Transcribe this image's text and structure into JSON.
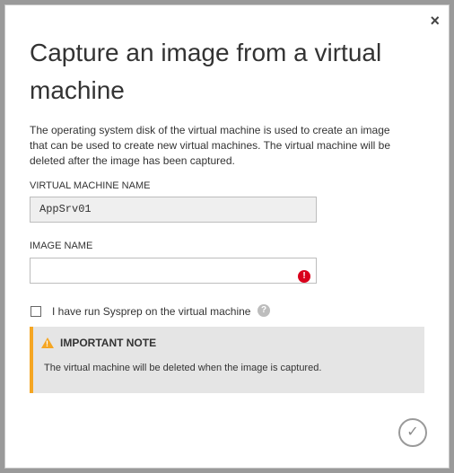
{
  "dialog": {
    "title": "Capture an image from a virtual machine",
    "description": "The operating system disk of the virtual machine is used to create an image that can be used to create new virtual machines. The virtual machine will be deleted after the image has been captured.",
    "close_glyph": "×",
    "vm_name_label": "VIRTUAL MACHINE NAME",
    "vm_name_value": "AppSrv01",
    "image_name_label": "IMAGE NAME",
    "image_name_value": "",
    "error_glyph": "!",
    "sysprep_label": "I have run Sysprep on the virtual machine",
    "sysprep_checked": false,
    "help_glyph": "?",
    "note_title": "IMPORTANT NOTE",
    "note_body": "The virtual machine will be deleted when the image is captured.",
    "ok_glyph": "✓"
  },
  "colors": {
    "accent_warning": "#f5a623",
    "error": "#d9001b",
    "overlay": "#9a9a9a"
  }
}
